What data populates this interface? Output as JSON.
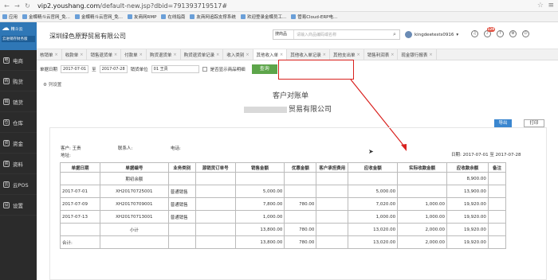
{
  "browser": {
    "url_main": "vip2.youshang.com",
    "url_rest": "/default-new.jsp?dbid=791393719517#"
  },
  "bookmarks": [
    "应用",
    "金蝶精斗云官网_免...",
    "金蝶精斗云官网_免...",
    "友商网RMP",
    "在线指南",
    "友商网追踪支撑系统",
    "欢迎登录金蝶员工...",
    "管易Cloud-ERP电..."
  ],
  "sidebar": {
    "logo_top": "精斗云",
    "logo_bottom": "云进销存财务版",
    "items": [
      {
        "icon": "电",
        "label": "电商"
      },
      {
        "icon": "购",
        "label": "购货"
      },
      {
        "icon": "销",
        "label": "销货"
      },
      {
        "icon": "仓",
        "label": "仓库"
      },
      {
        "icon": "资",
        "label": "资金"
      },
      {
        "icon": "资",
        "label": "资料"
      },
      {
        "icon": "云",
        "label": "云POS"
      },
      {
        "icon": "设",
        "label": "设置"
      }
    ]
  },
  "header": {
    "company": "深圳绿色原野贸易有限公司",
    "search_type": "搜商品",
    "search_placeholder": "请输入商品编码或名称",
    "user": "kingdeetests0916",
    "badge": "129"
  },
  "tabs": [
    "核销单",
    "收款单",
    "销售退货单",
    "付款单",
    "购货退货单",
    "购货退货单记录",
    "收入类别",
    "其他收入单",
    "其他收入单记录",
    "其他支出单",
    "销售利润表",
    "现金银行报表"
  ],
  "filter": {
    "start_label": "单据日期",
    "start": "2017-07-01",
    "to": "至",
    "end": "2017-07-28",
    "unit_label": "销货单位",
    "unit": "01 王贵",
    "checkbox_label": "是否显示商品明细",
    "query": "查询"
  },
  "list_setting": "列设置",
  "report": {
    "title": "客户对账单",
    "company_suffix": "贸易有限公司",
    "export": "导出",
    "print": "打印",
    "customer": "客户: 王贵",
    "contact": "联系人:",
    "phone": "电话:",
    "address": "地址:",
    "date": "日期: 2017-07-01 至 2017-07-28"
  },
  "table": {
    "headers": [
      "单据日期",
      "单据编号",
      "业务类别",
      "源销货订单号",
      "销售金额",
      "优惠金额",
      "客户承担费用",
      "应收金额",
      "实际收款金额",
      "应收款余额",
      "备注"
    ],
    "rows": [
      [
        "",
        "期初余额",
        "",
        "",
        "",
        "",
        "",
        "",
        "",
        "8,900.00",
        ""
      ],
      [
        "2017-07-01",
        "XH20170725001",
        "普通销售",
        "",
        "5,000.00",
        "",
        "",
        "5,000.00",
        "",
        "13,900.00",
        ""
      ],
      [
        "2017-07-09",
        "XH20170709001",
        "普通销售",
        "",
        "7,800.00",
        "780.00",
        "",
        "7,020.00",
        "1,000.00",
        "19,920.00",
        ""
      ],
      [
        "2017-07-13",
        "XH20170713001",
        "普通销售",
        "",
        "1,000.00",
        "",
        "",
        "1,000.00",
        "1,000.00",
        "19,920.00",
        ""
      ],
      [
        "",
        "小计",
        "",
        "",
        "13,800.00",
        "780.00",
        "",
        "13,020.00",
        "2,000.00",
        "19,920.00",
        ""
      ],
      [
        "合计:",
        "",
        "",
        "",
        "13,800.00",
        "780.00",
        "",
        "13,020.00",
        "2,000.00",
        "19,920.00",
        ""
      ]
    ]
  },
  "colors": {
    "accent": "#5da54a",
    "highlight": "#d9221f",
    "sidebar": "#2b2b2b",
    "link": "#3a86cf"
  }
}
